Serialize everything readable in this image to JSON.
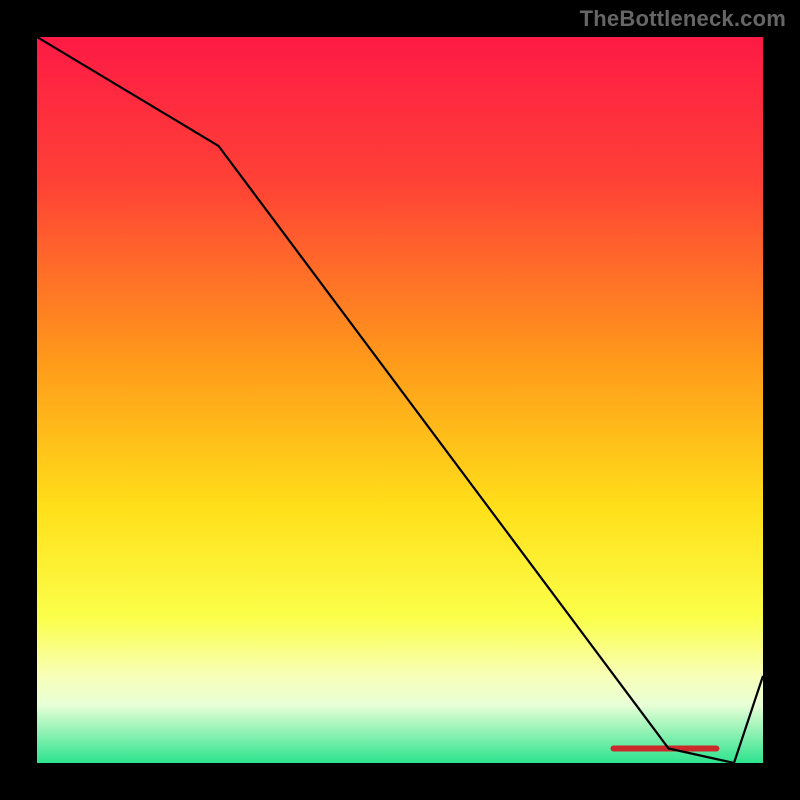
{
  "header": {
    "watermark": "TheBottleneck.com"
  },
  "chart_data": {
    "type": "line",
    "title": "",
    "xlabel": "",
    "ylabel": "",
    "x": [
      0,
      25,
      87,
      96,
      100
    ],
    "values": [
      100,
      85,
      2,
      0,
      12
    ],
    "xlim": [
      0,
      100
    ],
    "ylim": [
      0,
      100
    ],
    "background_gradient": {
      "stops": [
        {
          "pos": 0,
          "color": "#fd1a45"
        },
        {
          "pos": 20,
          "color": "#ff4136"
        },
        {
          "pos": 45,
          "color": "#ff9b1a"
        },
        {
          "pos": 65,
          "color": "#ffe01a"
        },
        {
          "pos": 80,
          "color": "#fbff4a"
        },
        {
          "pos": 88,
          "color": "#f8ffb8"
        },
        {
          "pos": 92,
          "color": "#e8ffd6"
        },
        {
          "pos": 100,
          "color": "#2de38e"
        }
      ]
    },
    "band": {
      "x0": 79,
      "x1": 94,
      "y": 2,
      "label": ""
    },
    "line_color": "#000000"
  }
}
